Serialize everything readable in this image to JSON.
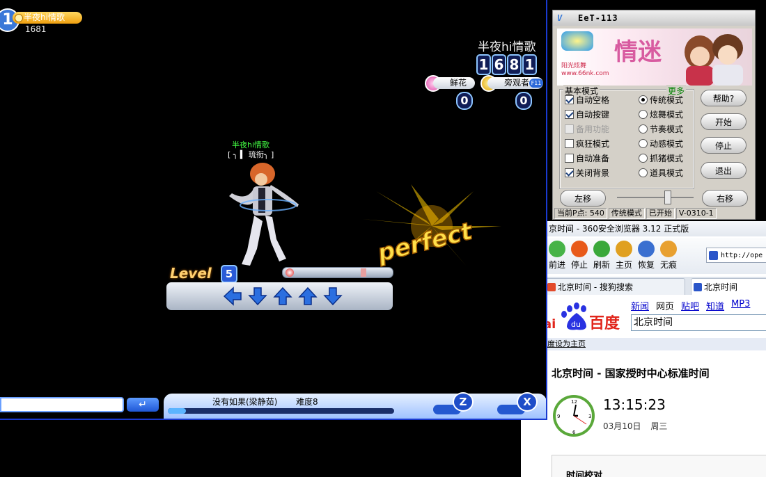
{
  "game": {
    "player_number": "1",
    "player_name": "半夜hi情歌",
    "player_score": "1681",
    "right_panel": {
      "name": "半夜hi情歌",
      "score_digits": [
        "1",
        "6",
        "8",
        "1"
      ],
      "flower_label": "鲜花",
      "flower_count": "0",
      "watcher_label": "旁观者",
      "watcher_hotkey": "F11",
      "watcher_count": "0"
    },
    "dancer_name": "半夜hi情歌",
    "dancer_tag": "[ ╮ ▍ 琉衔╮ ]",
    "judgement": "perfect",
    "level_label": "Level",
    "level_value": "5",
    "arrows": [
      "left",
      "down",
      "up",
      "up",
      "down"
    ],
    "song_title": "没有如果(梁静茹)",
    "difficulty": "难度8",
    "progress": 0.08,
    "enter_symbol": "↵",
    "z_label": "Z",
    "x_label": "X"
  },
  "tool": {
    "title": "EeT-113",
    "title_icon": "V",
    "banner": {
      "title": "情迷",
      "sub": "阳光炫舞",
      "url": "www.66nk.com"
    },
    "group_label": "基本模式",
    "more_label": "更多",
    "checkboxes": [
      {
        "label": "自动空格",
        "checked": true,
        "disabled": false
      },
      {
        "label": "自动按键",
        "checked": true,
        "disabled": false
      },
      {
        "label": "备用功能",
        "checked": false,
        "disabled": true
      },
      {
        "label": "疯狂模式",
        "checked": false,
        "disabled": false
      },
      {
        "label": "自动准备",
        "checked": false,
        "disabled": false
      },
      {
        "label": "关闭背景",
        "checked": true,
        "disabled": false
      }
    ],
    "radios": [
      {
        "label": "传统模式",
        "selected": true
      },
      {
        "label": "炫舞模式",
        "selected": false
      },
      {
        "label": "节奏模式",
        "selected": false
      },
      {
        "label": "动感模式",
        "selected": false
      },
      {
        "label": "抓猪模式",
        "selected": false
      },
      {
        "label": "道具模式",
        "selected": false
      }
    ],
    "buttons": {
      "help": "帮助?",
      "start": "开始",
      "stop": "停止",
      "exit": "退出",
      "left": "左移",
      "right": "右移"
    },
    "status": {
      "points": "当前P点: 540",
      "mode": "传统模式",
      "state": "已开始",
      "version": "V-0310-1"
    }
  },
  "browser": {
    "title": "京时间 - 360安全浏览器 3.12 正式版",
    "toolbar": [
      {
        "label": "前进",
        "icon": "forward-arrow-icon",
        "color": "#47b347"
      },
      {
        "label": "停止",
        "icon": "stop-icon",
        "color": "#e85a1a"
      },
      {
        "label": "刷新",
        "icon": "refresh-icon",
        "color": "#3aa83a"
      },
      {
        "label": "主页",
        "icon": "home-icon",
        "color": "#e0a020"
      },
      {
        "label": "恢复",
        "icon": "undo-icon",
        "color": "#3a6fd0"
      },
      {
        "label": "无痕",
        "icon": "paw-icon",
        "color": "#e8a030"
      }
    ],
    "address": "http://ope",
    "tabs": [
      {
        "label": "北京时间 - 搜狗搜索",
        "active": false
      },
      {
        "label": "北京时间",
        "active": true
      }
    ],
    "nav_links": [
      "新闻",
      "网页",
      "贴吧",
      "知道",
      "MP3"
    ],
    "logo_text": "百度",
    "search_value": "北京时间",
    "set_home": "度设为主页",
    "result_title": "北京时间 - 国家授时中心标准时间",
    "clock_time": "13:15:23",
    "clock_date": "03月10日",
    "clock_weekday": "周三",
    "calib_title": "时间校对"
  }
}
